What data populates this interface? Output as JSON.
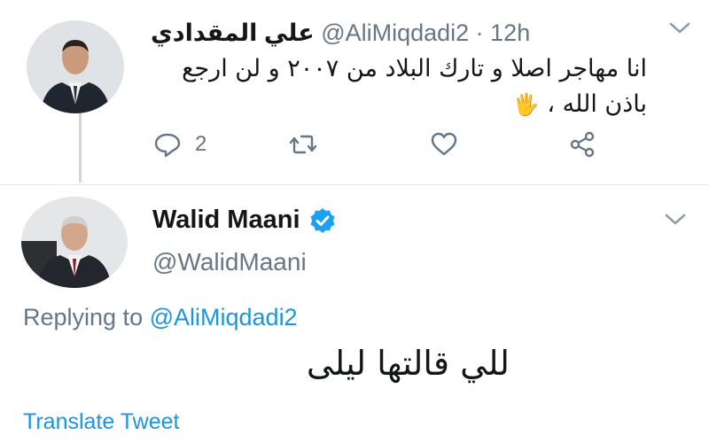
{
  "tweet1": {
    "author_name": "علي المقدادي",
    "handle_time": "@AliMiqdadi2 · 12h",
    "text": "انا مهاجر اصلا و تارك البلاد من ٢٠٠٧ و لن ارجع باذن الله ،",
    "emoji": "🖐",
    "reply_count": "2",
    "icons": [
      "reply-icon",
      "retweet-icon",
      "like-icon",
      "share-icon",
      "chevron-down-icon"
    ]
  },
  "tweet2": {
    "author_name": "Walid Maani",
    "handle": "@WalidMaani",
    "replying_prefix": "Replying to ",
    "replying_handle": "@AliMiqdadi2",
    "text": "للي قالتها ليلى",
    "translate_label": "Translate Tweet",
    "icons": [
      "verified-badge-icon",
      "chevron-down-icon"
    ]
  },
  "colors": {
    "text": "#14171a",
    "secondary": "#657786",
    "link": "#1b95e0",
    "verified": "#1da1f2"
  }
}
